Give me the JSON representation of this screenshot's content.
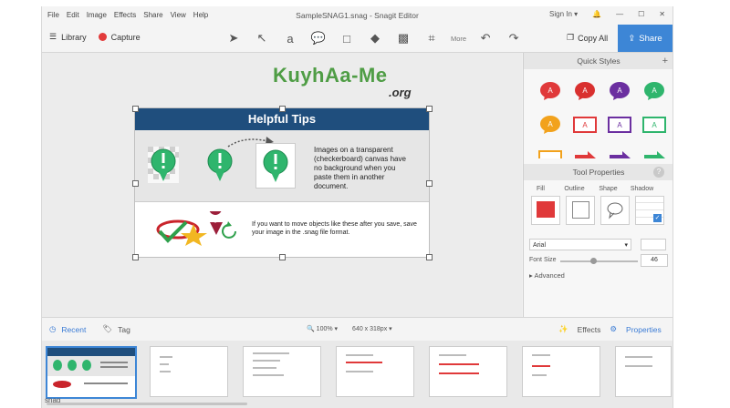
{
  "menubar": {
    "items": [
      "File",
      "Edit",
      "Image",
      "Effects",
      "Share",
      "View",
      "Help"
    ],
    "title": "SampleSNAG1.snag - Snagit Editor",
    "sign_in": "Sign In"
  },
  "toolbar": {
    "library": "Library",
    "capture": "Capture",
    "more": "More",
    "copy_all": "Copy All",
    "share": "Share"
  },
  "watermark": {
    "main": "KuyhAa-Me",
    "sub": ".org"
  },
  "canvas_card": {
    "title": "Helpful Tips",
    "mid_text": "Images on a transparent (checkerboard) canvas have no background when you paste them in another document.",
    "bottom_text": "If you want to move objects like these after you save, save your image in the .snag file format."
  },
  "panel": {
    "quick_styles": "Quick Styles",
    "style_letter": "A",
    "tool_properties": "Tool Properties",
    "help": "?",
    "fill": "Fill",
    "outline": "Outline",
    "shape": "Shape",
    "shadow": "Shadow",
    "font": "Arial",
    "font_size_label": "Font Size",
    "font_size": "46",
    "advanced": "Advanced"
  },
  "tray": {
    "recent": "Recent",
    "tag": "Tag",
    "zoom": "100%",
    "dimensions": "640 x 318px",
    "effects": "Effects",
    "properties": "Properties",
    "snag_label": "snag"
  },
  "colors": {
    "accent": "#3d86d6",
    "title_bar": "#1f4e7d",
    "callout_red": "#e0393a",
    "callout_purple": "#6b2fa0",
    "callout_green": "#2fb56d",
    "callout_orange": "#f2a21c"
  }
}
